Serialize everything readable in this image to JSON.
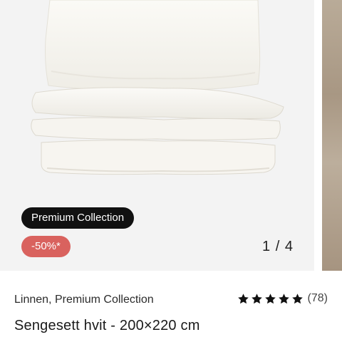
{
  "product": {
    "badges": {
      "collection": "Premium Collection",
      "discount": "-50%*"
    },
    "image_counter": "1 / 4",
    "brand": "Linnen, Premium Collection",
    "title": "Sengesett hvit - 200×220 cm",
    "rating": {
      "stars": 5,
      "review_count": "(78)"
    }
  },
  "colors": {
    "discount_badge": "#d9625e",
    "collection_badge": "#111111",
    "star": "#111111"
  }
}
